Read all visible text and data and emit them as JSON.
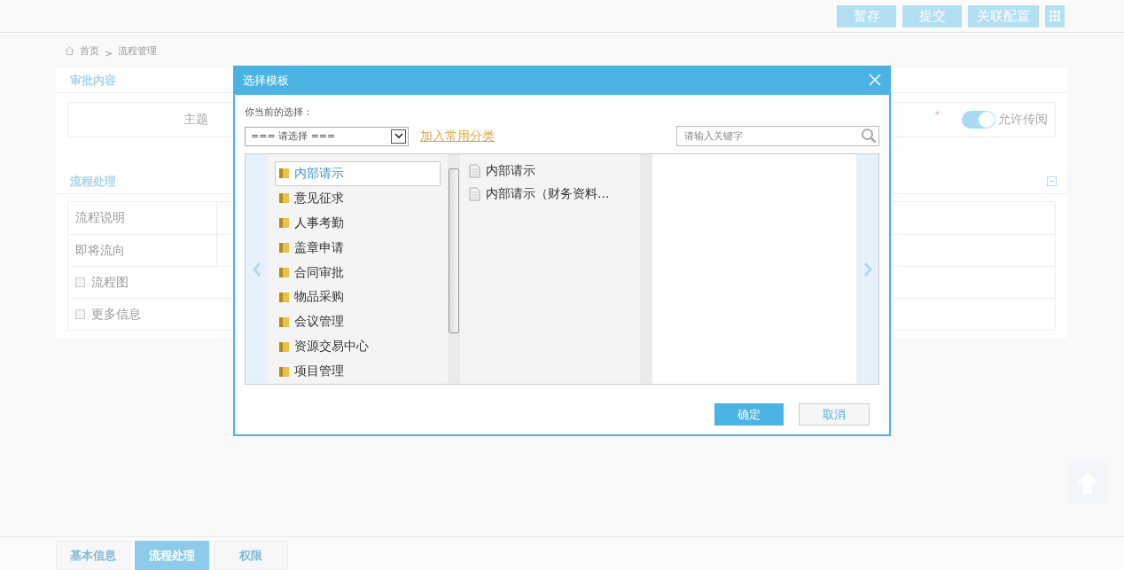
{
  "toolbar": {
    "buttons": [
      "暂存",
      "提交",
      "关联配置"
    ]
  },
  "breadcrumb": [
    "首页",
    ">",
    "流程管理"
  ],
  "approval": {
    "title": "审批内容",
    "subject_label": "主题",
    "required_mark": "*",
    "circulate": {
      "label": "允许传阅",
      "on": true
    }
  },
  "process": {
    "title": "流程处理",
    "rows": [
      {
        "kind": "field",
        "label": "流程说明"
      },
      {
        "kind": "field",
        "label": "即将流向"
      },
      {
        "kind": "checkbox",
        "label": "流程图",
        "checked": false
      },
      {
        "kind": "checkbox",
        "label": "更多信息",
        "checked": false
      }
    ]
  },
  "dialog": {
    "title": "选择模板",
    "current_label": "你当前的选择：",
    "select_value": "=== 请选择 ===",
    "add_link": "加入常用分类",
    "search_placeholder": "请输入关键字",
    "categories": [
      {
        "label": "内部请示",
        "selected": true
      },
      {
        "label": "意见征求",
        "selected": false
      },
      {
        "label": "人事考勤",
        "selected": false
      },
      {
        "label": "盖章申请",
        "selected": false
      },
      {
        "label": "合同审批",
        "selected": false
      },
      {
        "label": "物品采购",
        "selected": false
      },
      {
        "label": "会议管理",
        "selected": false
      },
      {
        "label": "资源交易中心",
        "selected": false
      },
      {
        "label": "项目管理",
        "selected": false
      }
    ],
    "templates": [
      "内部请示",
      "内部请示（财务资料..."
    ],
    "ok": "确定",
    "cancel": "取消"
  },
  "bottom_tabs": [
    {
      "label": "基本信息",
      "selected": false
    },
    {
      "label": "流程处理",
      "selected": true
    },
    {
      "label": "权限",
      "selected": false
    }
  ]
}
